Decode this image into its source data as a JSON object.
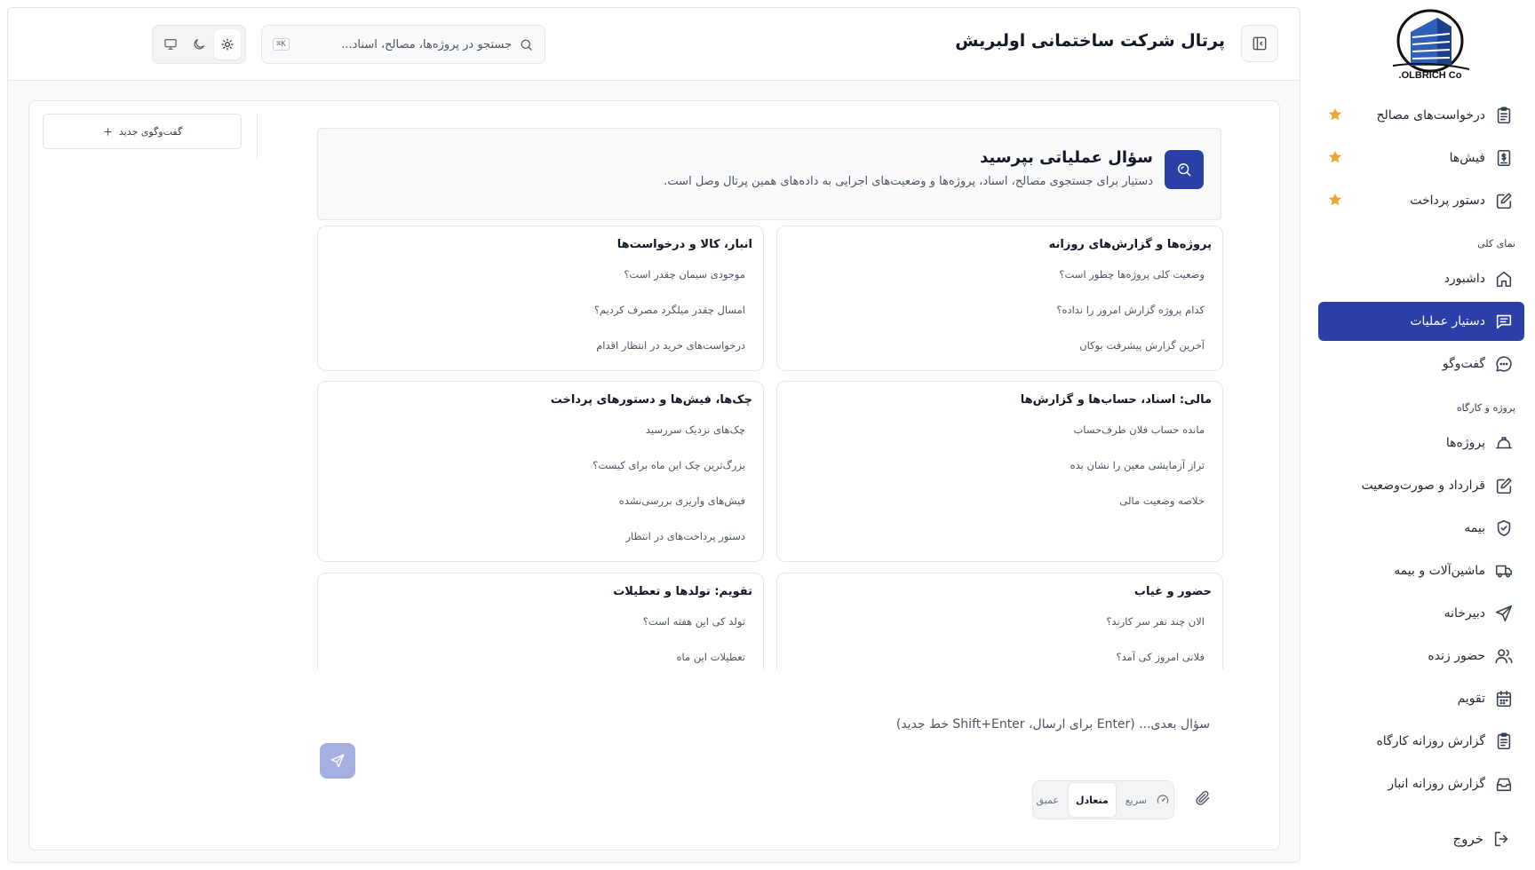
{
  "sidebar": {
    "logo_text": "OLBRICH Co.",
    "favorites": [
      {
        "label": "درخواست‌های مصالح",
        "icon": "clipboard-icon"
      },
      {
        "label": "فیش‌ها",
        "icon": "receipt-dollar-icon"
      },
      {
        "label": "دستور پرداخت",
        "icon": "pen-square-icon"
      }
    ],
    "section_overview": "نمای کلی",
    "overview_items": [
      {
        "label": "داشبورد",
        "icon": "home-icon"
      },
      {
        "label": "دستیار عملیات",
        "icon": "chat-lines-icon",
        "active": true
      },
      {
        "label": "گفت‌وگو",
        "icon": "chat-bubble-icon"
      }
    ],
    "section_projects": "پروژه و کارگاه",
    "project_items": [
      {
        "label": "پروژه‌ها",
        "icon": "hardhat-icon"
      },
      {
        "label": "قرارداد و صورت‌وضعیت",
        "icon": "pen-square-icon"
      },
      {
        "label": "بیمه",
        "icon": "shield-check-icon"
      },
      {
        "label": "ماشین‌آلات و بیمه",
        "icon": "truck-icon"
      },
      {
        "label": "دبیرخانه",
        "icon": "send-icon"
      },
      {
        "label": "حضور زنده",
        "icon": "users-icon"
      },
      {
        "label": "تقویم",
        "icon": "calendar-icon"
      },
      {
        "label": "گزارش روزانه کارگاه",
        "icon": "clipboard-icon"
      },
      {
        "label": "گزارش روزانه انبار",
        "icon": "inbox-icon"
      }
    ],
    "logout": "خروج"
  },
  "header": {
    "title": "پرتال شرکت ساختمانی اولبریش",
    "search_placeholder": "جستجو در پروژه‌ها، مصالح، اسناد...",
    "search_shortcut": "K⌘",
    "theme_selected": "light"
  },
  "conversations": {
    "new_label": "گفت‌وگوی جدید"
  },
  "intro": {
    "title": "سؤال عملیاتی بپرسید",
    "description": "دستیار برای جستجوی مصالح، اسناد، پروژه‌ها و وضعیت‌های اجرایی به داده‌های همین پرتال وصل است."
  },
  "cards": [
    {
      "title": "پروژه‌ها و گزارش‌های روزانه",
      "questions": [
        "وضعیت کلی پروژه‌ها چطور است؟",
        "کدام پروژه گزارش امروز را نداده؟",
        "آخرین گزارش پیشرفت بوکان"
      ]
    },
    {
      "title": "انبار، کالا و درخواست‌ها",
      "questions": [
        "موجودی سیمان چقدر است؟",
        "امسال چقدر میلگرد مصرف کردیم؟",
        "درخواست‌های خرید در انتظار اقدام"
      ]
    },
    {
      "title": "مالی: اسناد، حساب‌ها و گزارش‌ها",
      "questions": [
        "مانده حساب فلان طرف‌حساب",
        "تراز آزمایشی معین را نشان بده",
        "خلاصه وضعیت مالی"
      ]
    },
    {
      "title": "چک‌ها، فیش‌ها و دستورهای پرداخت",
      "questions": [
        "چک‌های نزدیک سررسید",
        "بزرگ‌ترین چک این ماه برای کیست؟",
        "فیش‌های واریزی بررسی‌نشده",
        "دستور پرداخت‌های در انتظار"
      ]
    },
    {
      "title": "حضور و غیاب",
      "questions": [
        "الان چند نفر سر کارند؟",
        "فلانی امروز کی آمد؟"
      ]
    },
    {
      "title": "تقویم: تولدها و تعطیلات",
      "questions": [
        "تولد کی این هفته است؟",
        "تعطیلات این ماه"
      ]
    }
  ],
  "composer": {
    "placeholder": "سؤال بعدی... (Enter برای ارسال، Shift+Enter خط جدید)",
    "modes": [
      "سریع",
      "متعادل",
      "عمیق"
    ],
    "selected_mode": "متعادل"
  },
  "colors": {
    "primary": "#2b3fa8",
    "favorite_star": "#f2a531",
    "send_disabled": "#a5b0e0"
  }
}
